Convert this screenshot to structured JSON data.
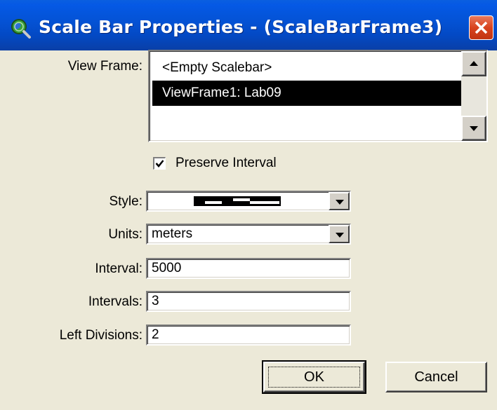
{
  "window": {
    "title": "Scale Bar Properties - (ScaleBarFrame3)",
    "icon": "globe-magnifier-icon",
    "close_icon": "close-icon"
  },
  "view_frame": {
    "label": "View Frame:",
    "items": [
      {
        "label": "<Empty Scalebar>",
        "selected": false
      },
      {
        "label": "ViewFrame1: Lab09",
        "selected": true
      }
    ]
  },
  "preserve_interval": {
    "label": "Preserve Interval",
    "checked": true
  },
  "style": {
    "label": "Style:",
    "value": "scale-bar-pattern"
  },
  "units": {
    "label": "Units:",
    "value": "meters"
  },
  "interval": {
    "label": "Interval:",
    "value": "5000"
  },
  "intervals": {
    "label": "Intervals:",
    "value": "3"
  },
  "left_divisions": {
    "label": "Left Divisions:",
    "value": "2"
  },
  "buttons": {
    "ok": "OK",
    "cancel": "Cancel"
  },
  "colors": {
    "titlebar": "#0453d6",
    "dialog_bg": "#ece9d8",
    "close_button": "#d8431e",
    "selection": "#000000"
  }
}
